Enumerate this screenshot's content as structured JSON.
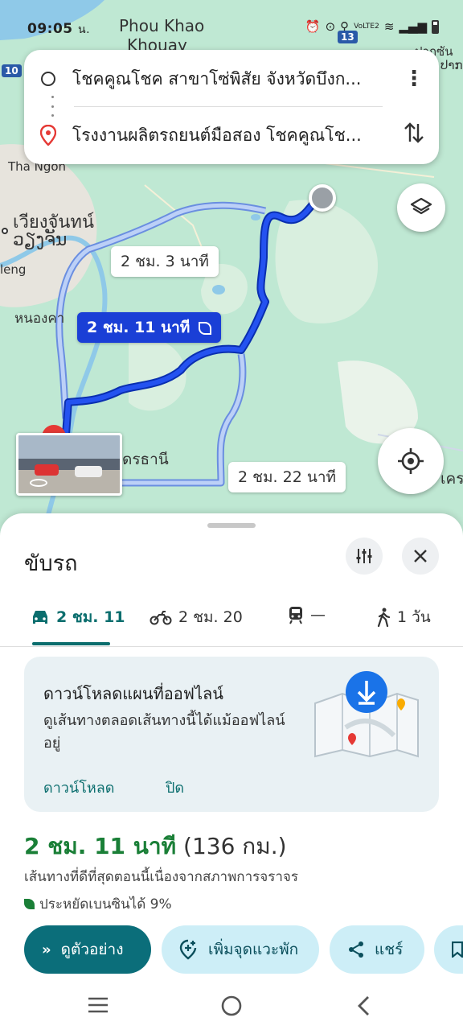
{
  "status": {
    "time": "09:05",
    "time_suffix": "น.",
    "network": "VoLTE2"
  },
  "map": {
    "labels": {
      "phou_khao_khouay_1": "Phou Khao",
      "phou_khao_khouay_2": "Khouay",
      "tha_ngon": "Tha Ngon",
      "vientiane_thai": "เวียงจันทน์",
      "vientiane_lao": "ວຽງຈັນ",
      "leng": "leng",
      "nong_khai": "หนองคา",
      "udon": "ดรธานี",
      "pak_san": "ปากซัน",
      "pak_san_lao": "ປາກ",
      "right_edge": "เคร"
    },
    "road_badges": {
      "left": "10",
      "top": "13"
    },
    "route_tags": {
      "alt1": "2 ชม. 3 นาที",
      "main": "2 ชม. 11 นาที",
      "alt2": "2 ชม. 22 นาที"
    }
  },
  "route_card": {
    "origin": "โชคคูณโชค สาขาโซ่พิสัย จังหวัดบึงก...",
    "destination": "โรงงานผลิตรถยนต์มือสอง โชคคูณโช..."
  },
  "sheet": {
    "title": "ขับรถ",
    "modes": [
      {
        "icon": "car-icon",
        "label": "2 ชม. 11"
      },
      {
        "icon": "motorcycle-icon",
        "label": "2 ชม. 20"
      },
      {
        "icon": "train-icon",
        "label": "—"
      },
      {
        "icon": "walk-icon",
        "label": "1 วัน"
      }
    ],
    "offline": {
      "title": "ดาวน์โหลดแผนที่ออฟไลน์",
      "description": "ดูเส้นทางตลอดเส้นทางนี้ได้แม้ออฟไลน์อยู่",
      "download": "ดาวน์โหลด",
      "close": "ปิด"
    },
    "summary": {
      "duration": "2 ชม. 11 นาที",
      "distance": "(136 กม.)",
      "note": "เส้นทางที่ดีที่สุดตอนนี้เนื่องจากสภาพการจราจร",
      "eco": "ประหยัดเบนซินได้ 9%"
    },
    "actions": {
      "preview": "ดูตัวอย่าง",
      "add_stop": "เพิ่มจุดแวะพัก",
      "share": "แชร์"
    }
  },
  "colors": {
    "route_main": "#1a3fd6",
    "route_alt": "#a7bdf2",
    "accent": "#0b6e7a",
    "green": "#1a7f37"
  }
}
